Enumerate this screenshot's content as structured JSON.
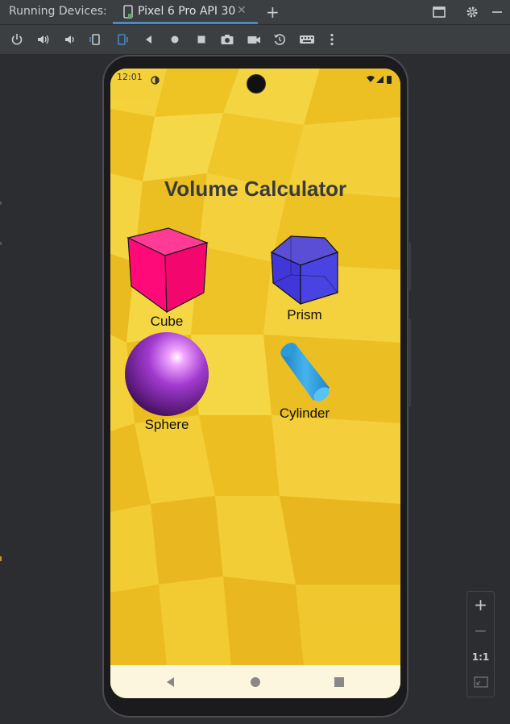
{
  "header": {
    "running_label": "Running Devices:",
    "tab_label": "Pixel 6 Pro API 30",
    "tab_close": "✕",
    "add_tab": "+"
  },
  "toolbar": {
    "icons": [
      "power-icon",
      "volume-up-icon",
      "volume-down-icon",
      "rotate-left-icon",
      "rotate-right-icon",
      "back-icon",
      "home-icon",
      "overview-icon",
      "screenshot-icon",
      "record-icon",
      "reset-icon",
      "keyboard-icon",
      "more-icon"
    ]
  },
  "status_bar": {
    "time": "12:01"
  },
  "app": {
    "title": "Volume Calculator",
    "shapes": [
      {
        "label": "Cube",
        "color": "#ff0a78"
      },
      {
        "label": "Prism",
        "color": "#4a40e0"
      },
      {
        "label": "Sphere",
        "color": "#9b2fc9"
      },
      {
        "label": "Cylinder",
        "color": "#2f9fd8"
      }
    ]
  },
  "zoom": {
    "plus": "+",
    "minus": "−",
    "one_to_one": "1:1"
  },
  "colors": {
    "accent": "#4a88c7",
    "background": "#f2cf2c"
  }
}
